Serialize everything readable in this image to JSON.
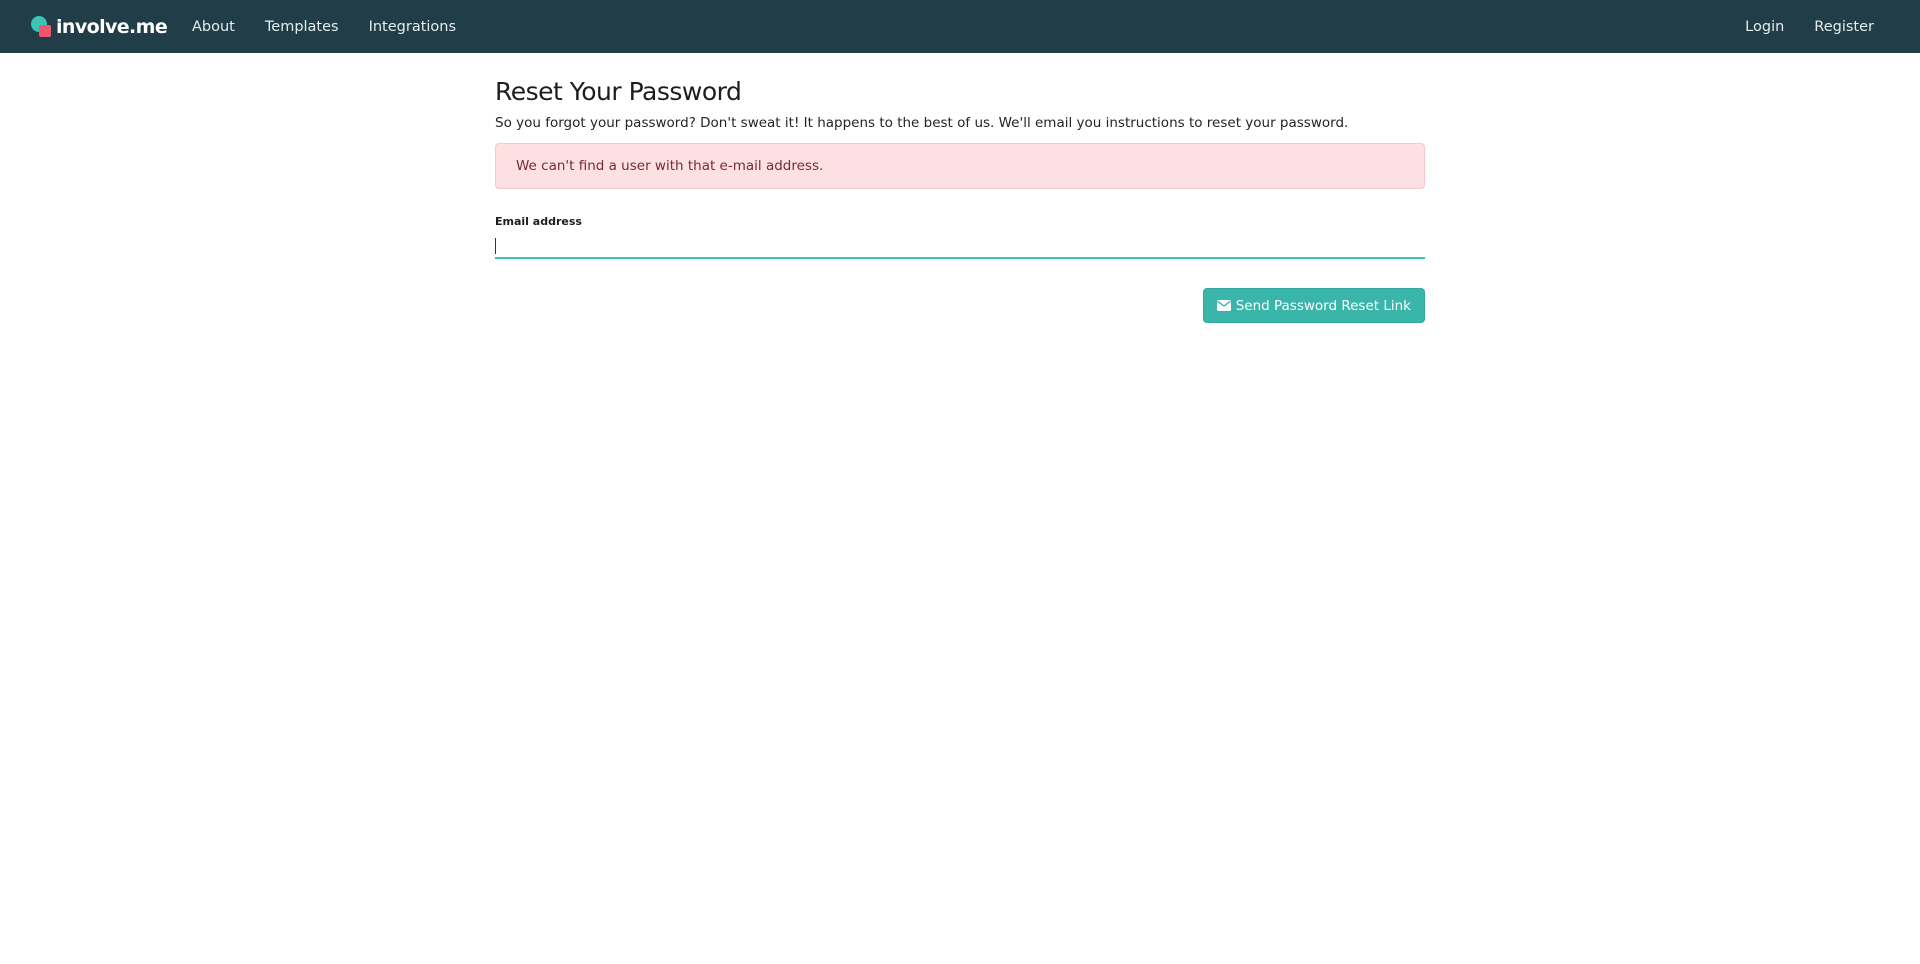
{
  "navbar": {
    "brand": "involve.me",
    "left_links": [
      {
        "label": "About"
      },
      {
        "label": "Templates"
      },
      {
        "label": "Integrations"
      }
    ],
    "right_links": [
      {
        "label": "Login"
      },
      {
        "label": "Register"
      }
    ]
  },
  "page": {
    "title": "Reset Your Password",
    "subtitle": "So you forgot your password? Don't sweat it! It happens to the best of us. We'll email you instructions to reset your password."
  },
  "alert": {
    "message": "We can't find a user with that e-mail address."
  },
  "form": {
    "email_label": "Email address",
    "email_value": "",
    "email_placeholder": "",
    "submit_label": "Send Password Reset Link",
    "submit_icon": "envelope-icon"
  },
  "colors": {
    "navbar_bg": "#203d48",
    "accent": "#39c5b6",
    "button_bg": "#3ab5a9",
    "alert_bg": "#fde0e1",
    "alert_text": "#7a2b30",
    "logo_coral": "#f0576f"
  }
}
